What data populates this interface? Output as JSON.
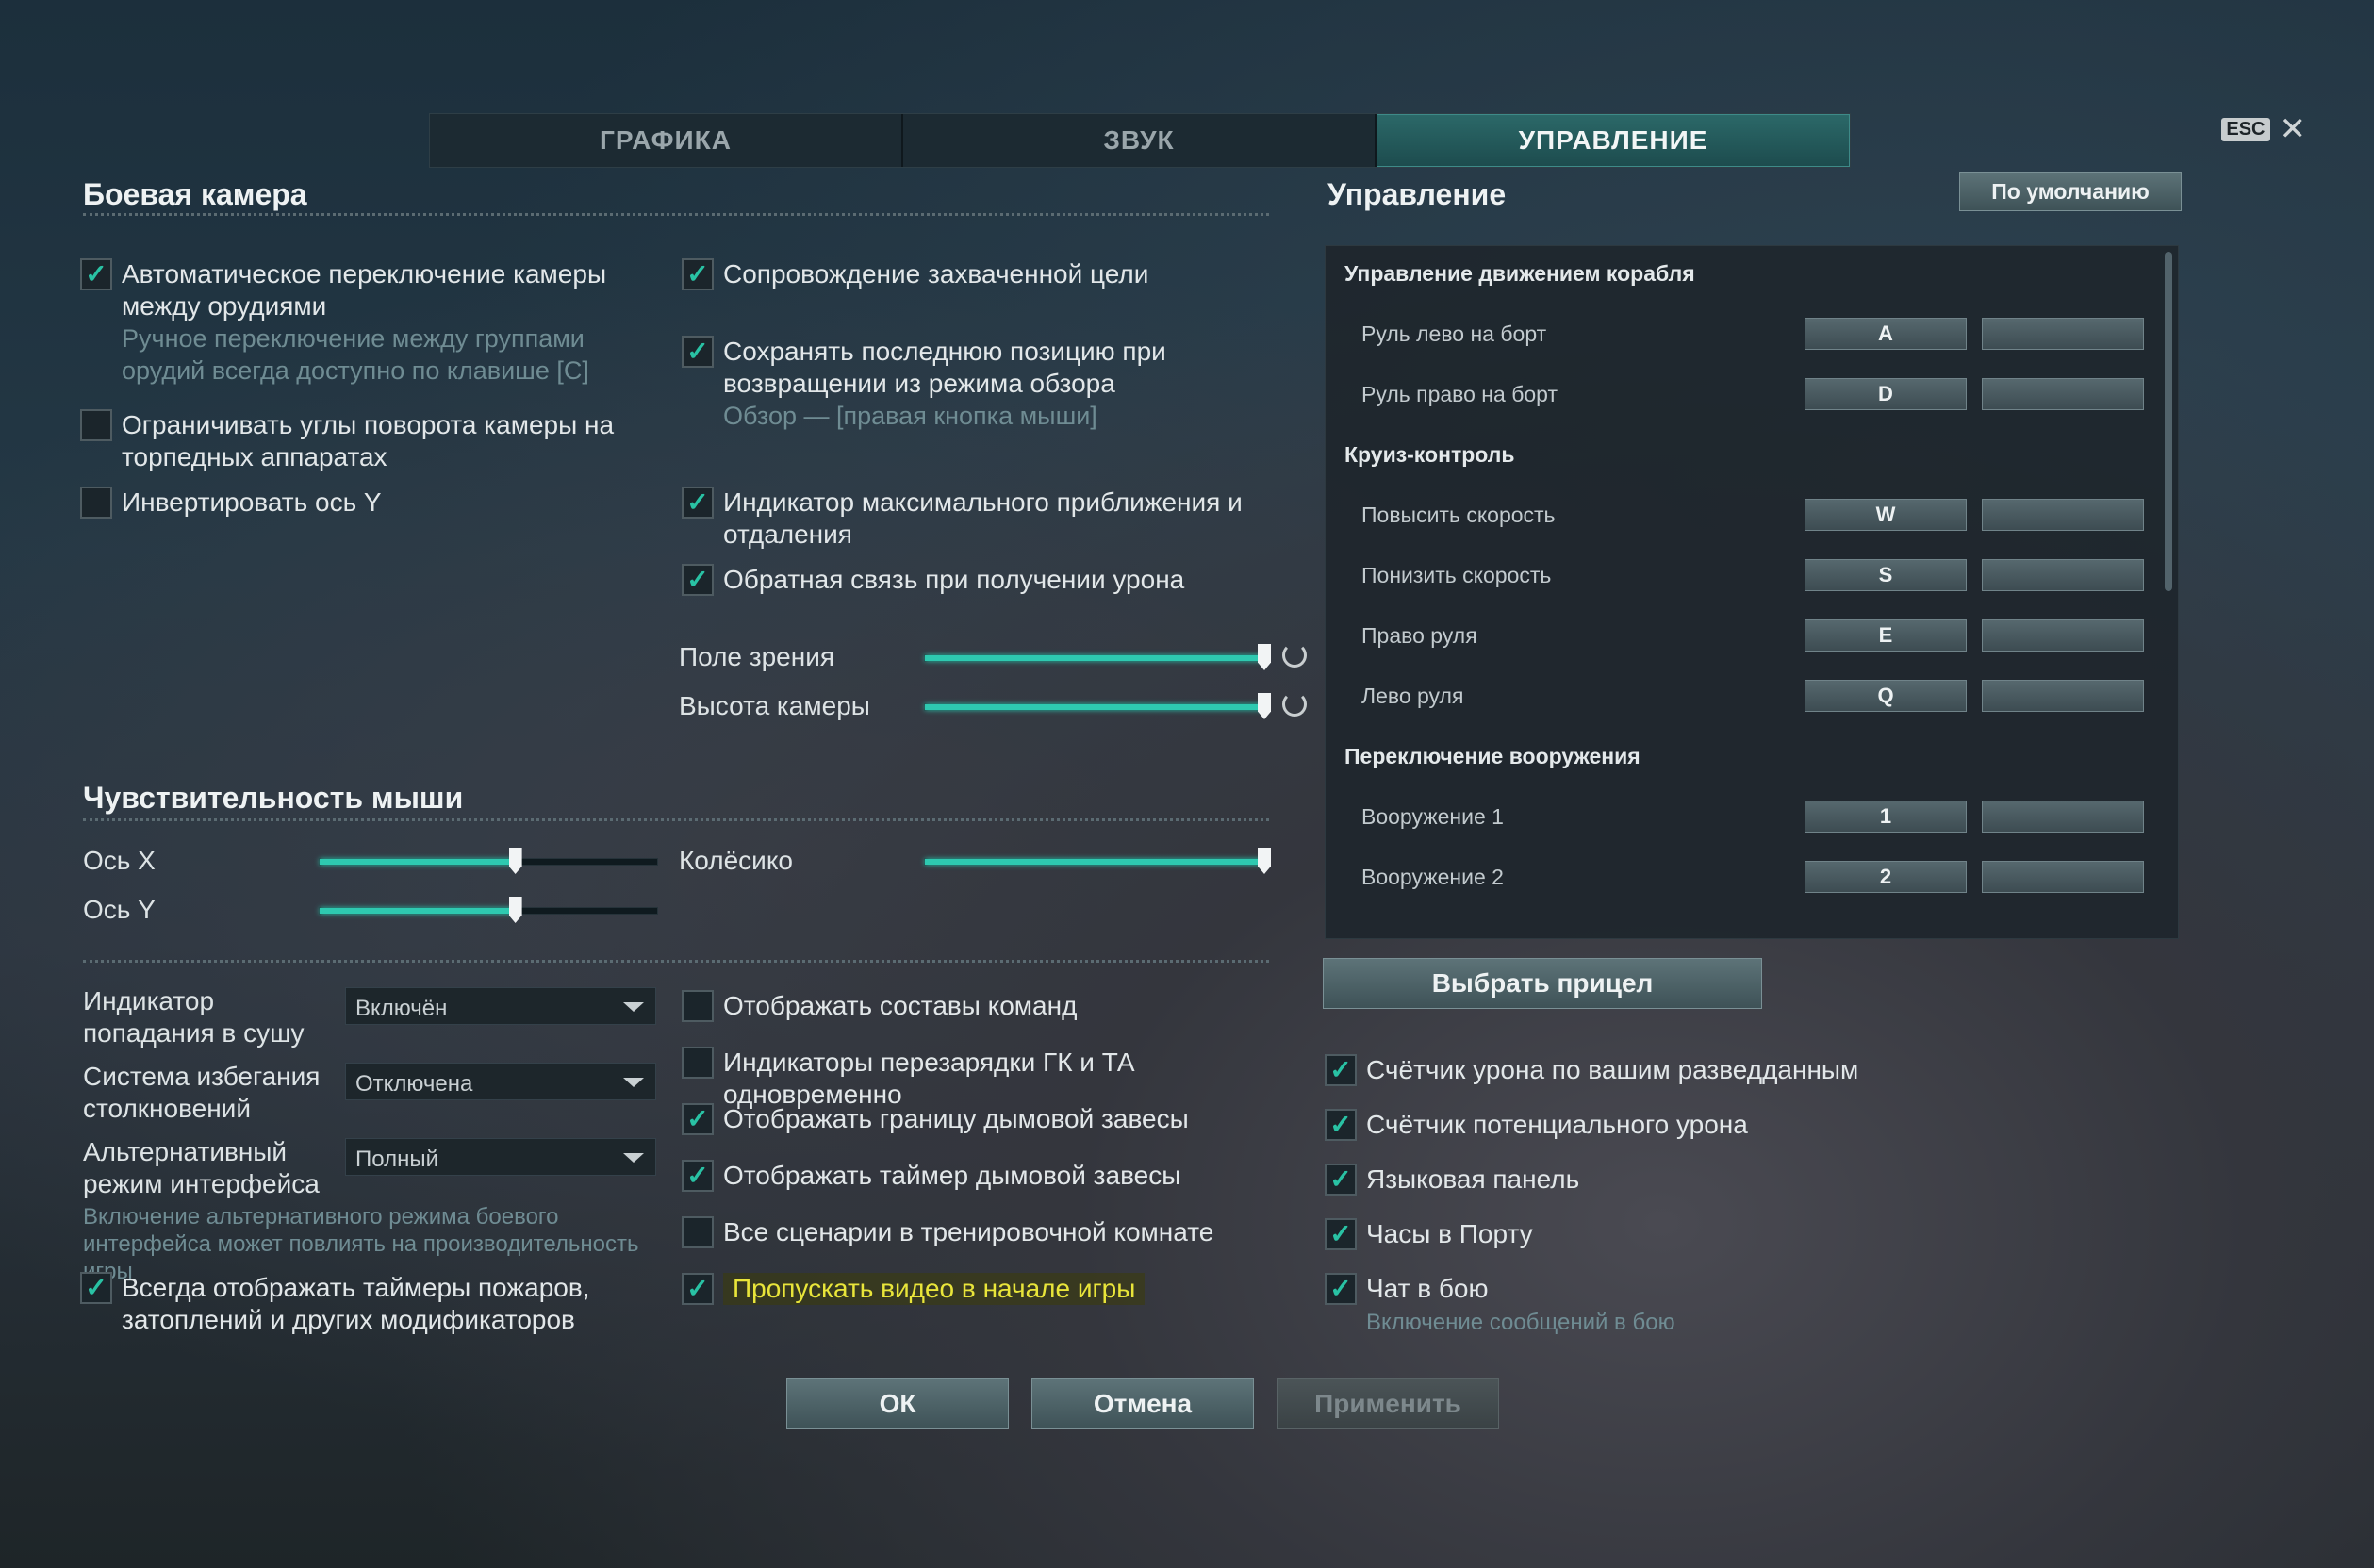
{
  "tabs": [
    "ГРАФИКА",
    "ЗВУК",
    "УПРАВЛЕНИЕ"
  ],
  "esc": {
    "badge": "ESC",
    "close": "✕"
  },
  "camera": {
    "title": "Боевая камера",
    "auto_switch": {
      "label": "Автоматическое переключение камеры между орудиями",
      "hint": "Ручное переключение между группами орудий всегда доступно по клавише [C]",
      "checked": true
    },
    "limit_angles": {
      "label": "Ограничивать углы поворота камеры на торпедных аппаратах",
      "checked": false
    },
    "invert_y": {
      "label": "Инвертировать ось Y",
      "checked": false
    },
    "track_target": {
      "label": "Сопровождение захваченной цели",
      "checked": true
    },
    "save_position": {
      "label": "Сохранять последнюю позицию при возвращении из режима обзора",
      "hint": "Обзор — [правая кнопка мыши]",
      "checked": true
    },
    "zoom_indicator": {
      "label": "Индикатор максимального приближения и отдаления",
      "checked": true
    },
    "damage_feedback": {
      "label": "Обратная связь при получении урона",
      "checked": true
    },
    "fov": {
      "label": "Поле зрения",
      "value": 1.0
    },
    "height": {
      "label": "Высота камеры",
      "value": 1.0
    }
  },
  "mouse": {
    "title": "Чувствительность мыши",
    "x": {
      "label": "Ось X",
      "value": 0.58
    },
    "y": {
      "label": "Ось Y",
      "value": 0.58
    },
    "wheel": {
      "label": "Колёсико",
      "value": 1.0
    }
  },
  "misc": {
    "hit_indicator": {
      "label": "Индикатор попадания в сушу",
      "value": "Включён"
    },
    "collision": {
      "label": "Система избегания столкновений",
      "value": "Отключена"
    },
    "alt_mode": {
      "label": "Альтернативный режим интерфейса",
      "value": "Полный"
    },
    "alt_hint": "Включение альтернативного режима боевого интерфейса может повлиять на производительность игры",
    "timers": {
      "label": "Всегда отображать таймеры пожаров, затоплений и других модификаторов",
      "checked": true
    },
    "team_roster": {
      "label": "Отображать составы команд",
      "checked": false
    },
    "reload_ind": {
      "label": "Индикаторы перезарядки ГК и ТА одновременно",
      "checked": false
    },
    "smoke_border": {
      "label": "Отображать границу дымовой завесы",
      "checked": true
    },
    "smoke_timer": {
      "label": "Отображать таймер дымовой завесы",
      "checked": true
    },
    "training": {
      "label": "Все сценарии в тренировочной комнате",
      "checked": false
    },
    "skip_video": {
      "label": "Пропускать видео в начале игры",
      "checked": true
    }
  },
  "controls": {
    "title": "Управление",
    "default_btn": "По умолчанию",
    "groups": {
      "movement": "Управление движением корабля",
      "cruise": "Круиз-контроль",
      "weapons": "Переключение вооружения"
    },
    "rows": [
      {
        "label": "Руль лево на борт",
        "key": "A"
      },
      {
        "label": "Руль право на борт",
        "key": "D"
      },
      {
        "label": "Повысить скорость",
        "key": "W"
      },
      {
        "label": "Понизить скорость",
        "key": "S"
      },
      {
        "label": "Право руля",
        "key": "E"
      },
      {
        "label": "Лево руля",
        "key": "Q"
      },
      {
        "label": "Вооружение 1",
        "key": "1"
      },
      {
        "label": "Вооружение 2",
        "key": "2"
      }
    ],
    "choose_sight": "Выбрать прицел"
  },
  "right_options": {
    "spot_damage": {
      "label": "Счётчик урона по вашим разведданным",
      "checked": true
    },
    "potential_damage": {
      "label": "Счётчик потенциального урона",
      "checked": true
    },
    "lang_panel": {
      "label": "Языковая панель",
      "checked": true
    },
    "port_clock": {
      "label": "Часы в Порту",
      "checked": true
    },
    "battle_chat": {
      "label": "Чат в бою",
      "hint": "Включение сообщений в бою",
      "checked": true
    }
  },
  "footer": {
    "ok": "ОК",
    "cancel": "Отмена",
    "apply": "Применить"
  },
  "colors": {
    "accent": "#2ec9b0",
    "highlight": "#e9e53a"
  }
}
